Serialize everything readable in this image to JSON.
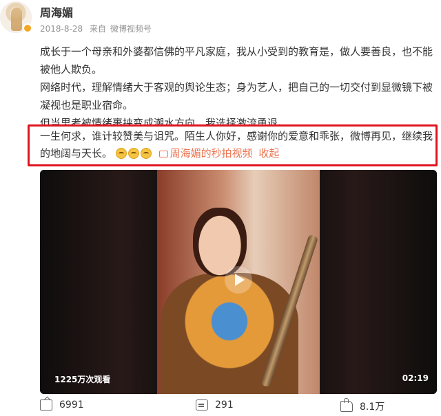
{
  "post": {
    "username": "周海媚",
    "date": "2018-8-28",
    "source_prefix": "来自",
    "source": "微博视频号"
  },
  "content": {
    "paragraph1": "成长于一个母亲和外婆都信佛的平凡家庭，我从小受到的教育是，做人要善良，也不能被他人欺负。",
    "paragraph2": "网络时代，理解情绪大于客观的舆论生态；身为艺人，把自己的一切交付到显微镜下被凝视也是职业宿命。",
    "paragraph3": "但当思考被情绪裹挟变成潮水方向，我选择激流勇退。",
    "highlighted": "一生何求，谁计较赞美与诅咒。陌生人你好，感谢你的爱意和乖张，微博再见，继续我的地阔与天长。",
    "video_link": "周海媚的秒拍视频",
    "collapse": "收起"
  },
  "video": {
    "views": "1225万次观看",
    "duration": "02:19"
  },
  "actions": {
    "share_count": "6991",
    "comment_count": "291",
    "like_count": "8.1万"
  },
  "colors": {
    "highlight_border": "#e0141e",
    "link": "#eb7350",
    "verified_badge": "#f5a623"
  }
}
